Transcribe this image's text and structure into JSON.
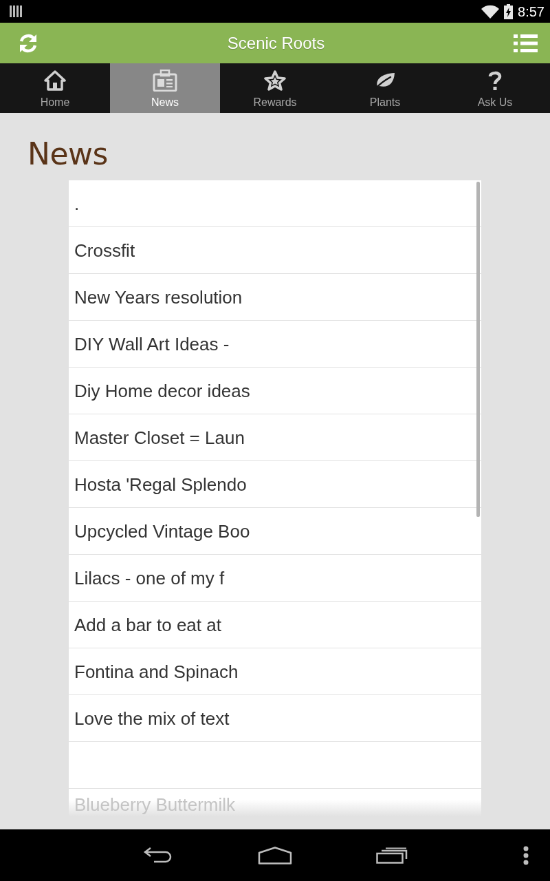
{
  "status_bar": {
    "time": "8:57"
  },
  "action_bar": {
    "title": "Scenic Roots"
  },
  "tabs": [
    {
      "label": "Home",
      "selected": false
    },
    {
      "label": "News",
      "selected": true
    },
    {
      "label": "Rewards",
      "selected": false
    },
    {
      "label": "Plants",
      "selected": false
    },
    {
      "label": "Ask Us",
      "selected": false
    }
  ],
  "page": {
    "heading": "News"
  },
  "news_list": {
    "items": [
      {
        "kind": "title",
        "title": "."
      },
      {
        "kind": "title",
        "title": "Crossfit"
      },
      {
        "kind": "title",
        "title": "New Years resolution"
      },
      {
        "kind": "title",
        "title": "DIY Wall Art Ideas -"
      },
      {
        "kind": "title",
        "title": "Diy Home decor ideas"
      },
      {
        "kind": "title",
        "title": "Master Closet = Laun"
      },
      {
        "kind": "title",
        "title": "Hosta 'Regal Splendo"
      },
      {
        "kind": "title",
        "title": "Upcycled Vintage Boo"
      },
      {
        "kind": "title",
        "title": "Lilacs - one of my f"
      },
      {
        "kind": "title",
        "title": "Add a bar to eat at"
      },
      {
        "kind": "title",
        "title": "Fontina and Spinach"
      },
      {
        "kind": "title",
        "title": "Love the mix of text"
      },
      {
        "kind": "blank"
      },
      {
        "kind": "faded",
        "title": "Blueberry Buttermilk"
      }
    ]
  }
}
